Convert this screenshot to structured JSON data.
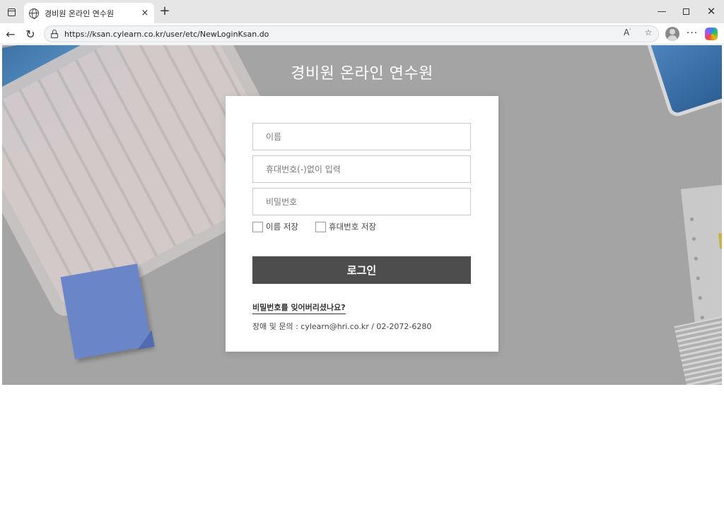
{
  "browser": {
    "tab_title": "경비원 온라인 연수원",
    "tab_close": "×",
    "new_tab": "+",
    "url": "https://ksan.cylearn.co.kr/user/etc/NewLoginKsan.do",
    "read_aloud_icon": "A̅",
    "favorite_icon": "☆",
    "more_label": "···",
    "back_icon": "←",
    "reload_icon": "↻",
    "minimize_icon": "—",
    "close_icon": "✕"
  },
  "page": {
    "title": "경비원 온라인 연수원"
  },
  "login": {
    "name_placeholder": "이름",
    "phone_placeholder": "휴대번호(-)없이 입력",
    "password_placeholder": "비밀번호",
    "save_name_label": "이름 저장",
    "save_phone_label": "휴대번호 저장",
    "login_button": "로그인",
    "forgot_password": "비밀번호를 잊어버리셨나요?",
    "contact": "장애 및 문의 : cylearn@hri.co.kr / 02-2072-6280"
  },
  "colors": {
    "hero_bg": "#a4a4a4",
    "button_bg": "#4d4d4d",
    "card_bg": "#ffffff"
  }
}
